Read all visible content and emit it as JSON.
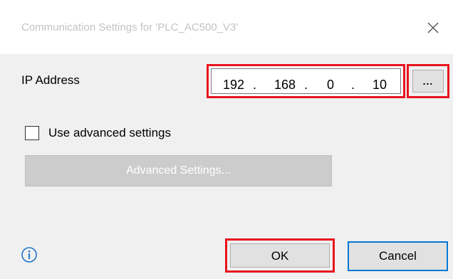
{
  "dialog": {
    "title": "Communication Settings for 'PLC_AC500_V3'"
  },
  "ip": {
    "label": "IP Address",
    "octets": [
      "192",
      "168",
      "0",
      "10"
    ],
    "dots": [
      ".",
      ".",
      "."
    ],
    "browse_label": "..."
  },
  "advanced": {
    "checkbox_label": "Use advanced settings",
    "checked": false,
    "button_label": "Advanced Settings..."
  },
  "footer": {
    "ok_label": "OK",
    "cancel_label": "Cancel"
  },
  "colors": {
    "highlight": "#e8141e",
    "focus": "#0078d7",
    "info": "#1e73c8"
  },
  "icons": {
    "close": "close-icon",
    "info": "info-icon"
  }
}
